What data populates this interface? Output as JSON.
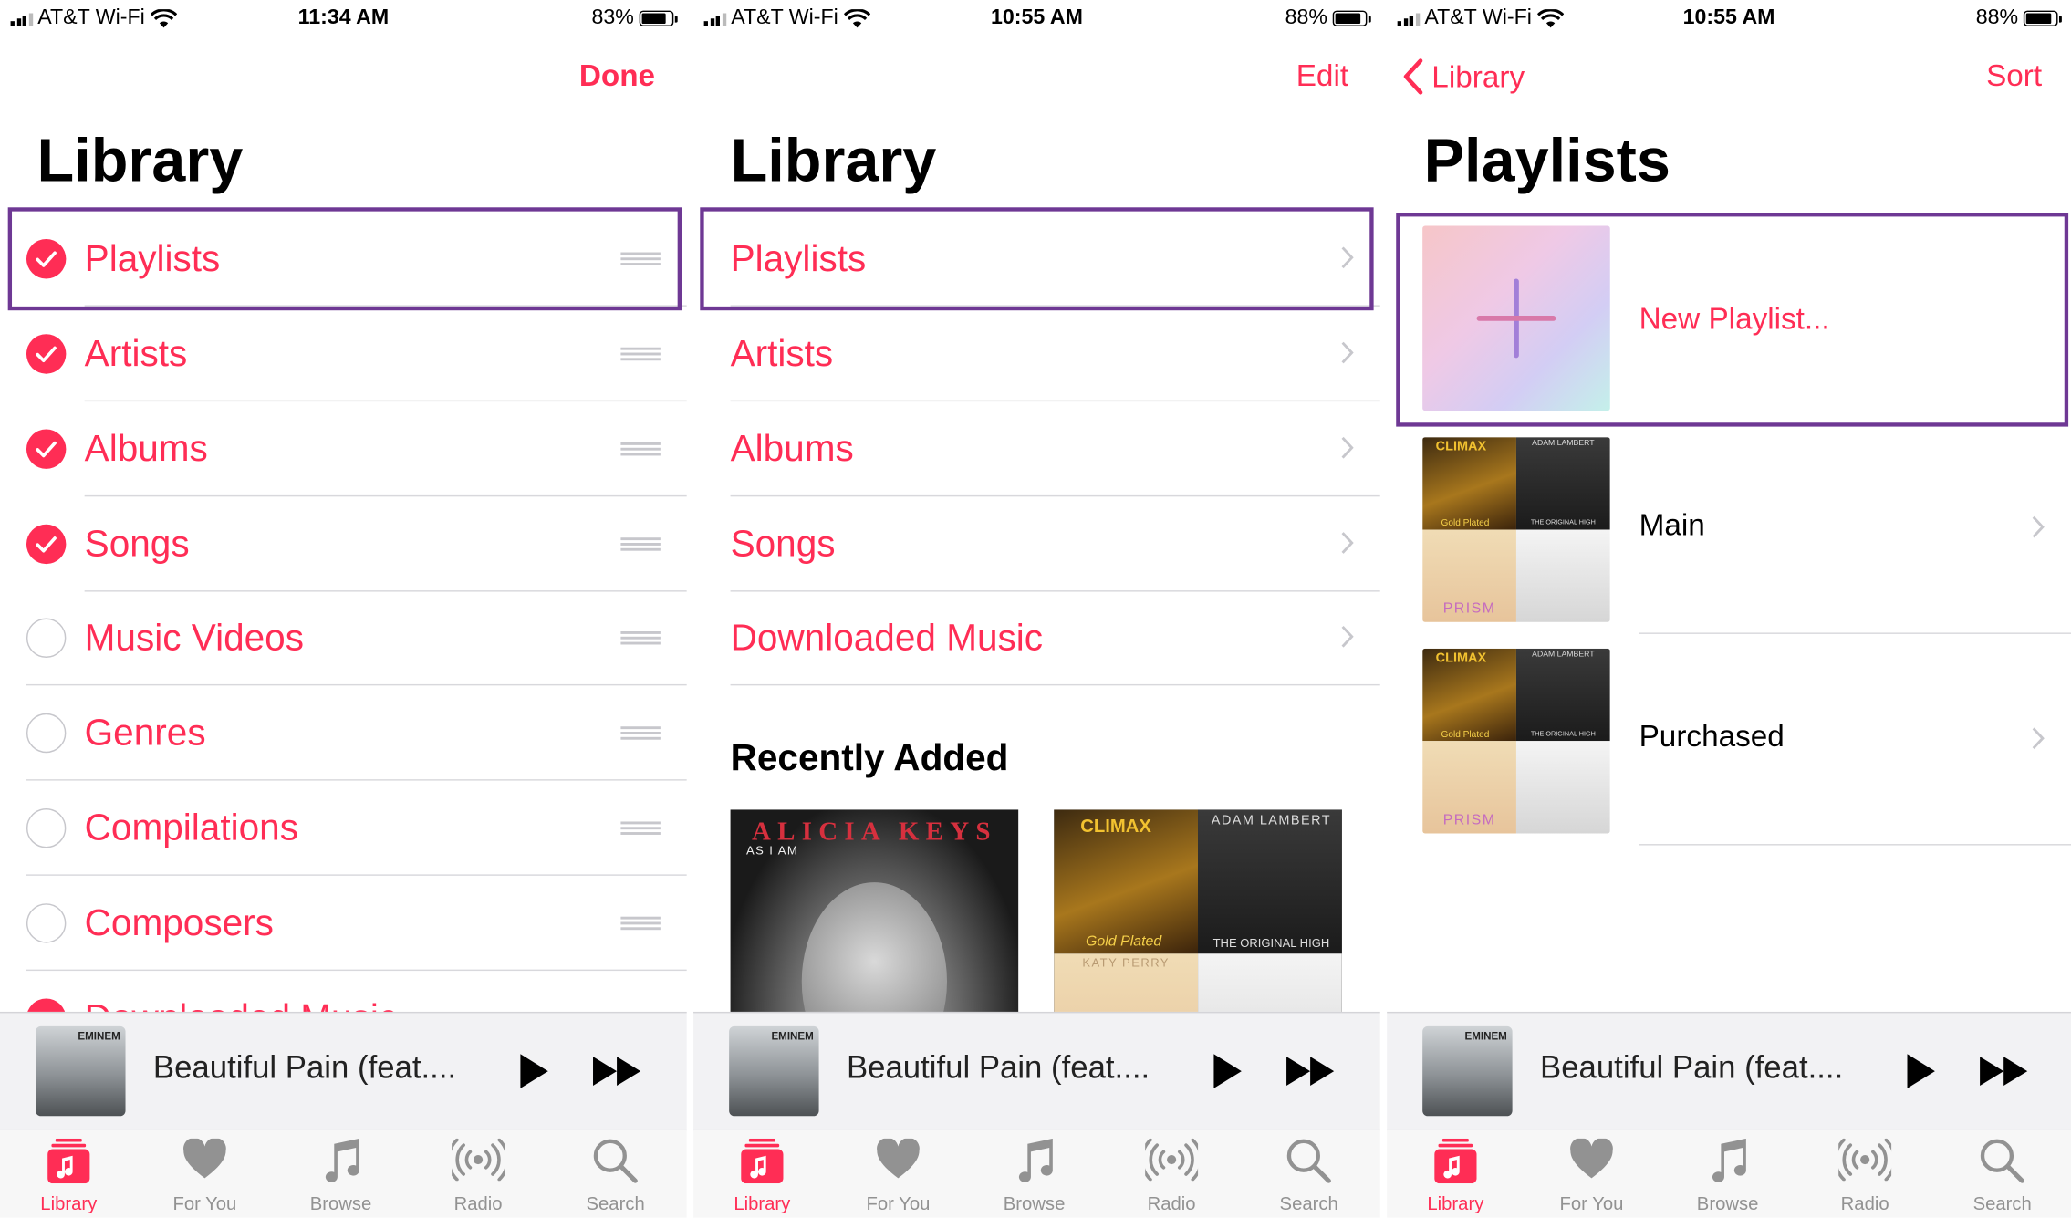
{
  "status_bars": [
    {
      "carrier": "AT&T Wi-Fi",
      "time": "11:34 AM",
      "battery": "83%"
    },
    {
      "carrier": "AT&T Wi-Fi",
      "time": "10:55 AM",
      "battery": "88%"
    },
    {
      "carrier": "AT&T Wi-Fi",
      "time": "10:55 AM",
      "battery": "88%"
    }
  ],
  "edit_screen": {
    "nav_action": "Done",
    "title": "Library",
    "items": [
      {
        "label": "Playlists",
        "checked": true
      },
      {
        "label": "Artists",
        "checked": true
      },
      {
        "label": "Albums",
        "checked": true
      },
      {
        "label": "Songs",
        "checked": true
      },
      {
        "label": "Music Videos",
        "checked": false
      },
      {
        "label": "Genres",
        "checked": false
      },
      {
        "label": "Compilations",
        "checked": false
      },
      {
        "label": "Composers",
        "checked": false
      },
      {
        "label": "Downloaded Music",
        "checked": true
      }
    ]
  },
  "library_screen": {
    "nav_action": "Edit",
    "title": "Library",
    "items": [
      "Playlists",
      "Artists",
      "Albums",
      "Songs",
      "Downloaded Music"
    ],
    "recently_added_title": "Recently Added",
    "albums": [
      {
        "artist": "ALICIA KEYS",
        "album": "AS I AM"
      },
      {
        "tile_texts": [
          "CLIMAX",
          "ADAM LAMBERT",
          "Gold Plated",
          "THE ORIGINAL HIGH",
          "KATY PERRY"
        ]
      }
    ]
  },
  "playlists_screen": {
    "back_label": "Library",
    "nav_action": "Sort",
    "title": "Playlists",
    "new_playlist_label": "New Playlist...",
    "playlists": [
      "Main",
      "Purchased"
    ],
    "mosaic_texts": [
      "CLIMAX",
      "ADAM LAMBERT",
      "Gold Plated",
      "THE ORIGINAL HIGH",
      "PRISM"
    ]
  },
  "mini_player": {
    "song": "Beautiful Pain (feat....",
    "art_text": "EMINEM"
  },
  "tab_bar": {
    "tabs": [
      {
        "label": "Library",
        "icon": "library-icon",
        "active": true
      },
      {
        "label": "For You",
        "icon": "heart-icon",
        "active": false
      },
      {
        "label": "Browse",
        "icon": "music-note-icon",
        "active": false
      },
      {
        "label": "Radio",
        "icon": "radio-icon",
        "active": false
      },
      {
        "label": "Search",
        "icon": "search-icon",
        "active": false
      }
    ]
  },
  "colors": {
    "accent": "#ff2d55",
    "highlight_box": "#6e3894",
    "separator": "#d8d8dc",
    "tab_inactive": "#929292"
  }
}
